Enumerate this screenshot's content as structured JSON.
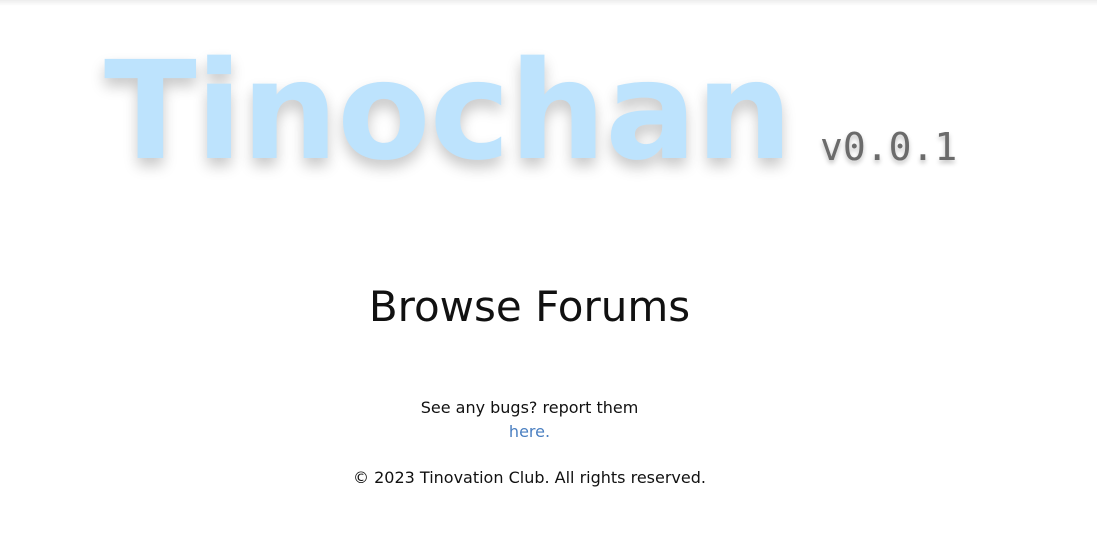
{
  "header": {
    "logo_text": "Tinochan",
    "version": "v0.0.1"
  },
  "main": {
    "browse_label": "Browse Forums"
  },
  "bugs": {
    "text": "See any bugs? report them",
    "link_label": "here."
  },
  "footer": {
    "copyright": "© 2023 Tinovation Club. All rights reserved."
  },
  "colors": {
    "logo": "#bde3fd",
    "link": "#4a7fc1",
    "version": "#6b6b6b"
  }
}
